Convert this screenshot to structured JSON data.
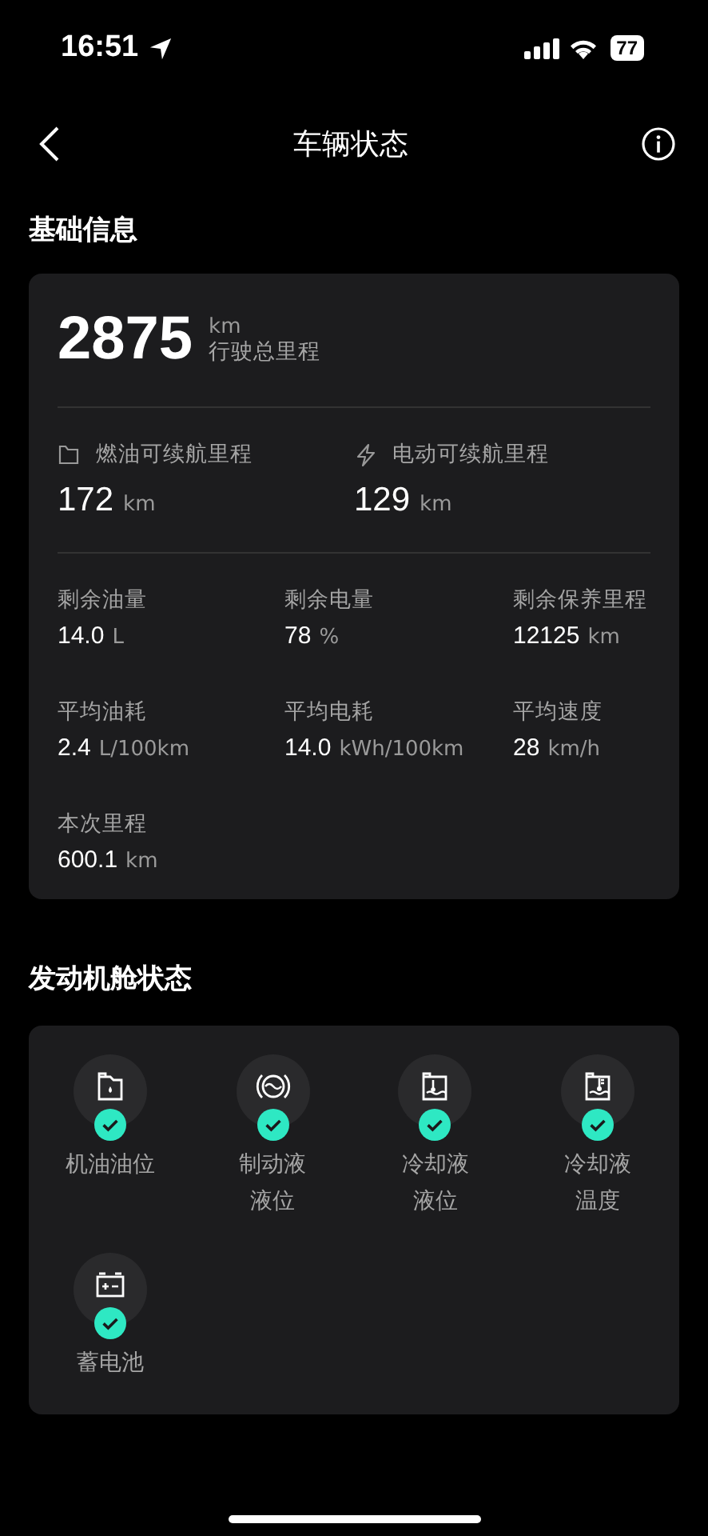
{
  "status_bar": {
    "time": "16:51",
    "battery": "77"
  },
  "nav": {
    "title": "车辆状态"
  },
  "basic": {
    "title": "基础信息",
    "total": {
      "value": "2875",
      "unit": "km",
      "label": "行驶总里程"
    },
    "ranges": [
      {
        "kind": "fuel",
        "label": "燃油可续航里程",
        "value": "172",
        "unit": "km"
      },
      {
        "kind": "electric",
        "label": "电动可续航里程",
        "value": "129",
        "unit": "km"
      }
    ],
    "stats": [
      {
        "label": "剩余油量",
        "value": "14.0",
        "unit": "L"
      },
      {
        "label": "剩余电量",
        "value": "78",
        "unit": "%"
      },
      {
        "label": "剩余保养里程",
        "value": "12125",
        "unit": "km"
      },
      {
        "label": "平均油耗",
        "value": "2.4",
        "unit": "L/100km"
      },
      {
        "label": "平均电耗",
        "value": "14.0",
        "unit": "kWh/100km"
      },
      {
        "label": "平均速度",
        "value": "28",
        "unit": "km/h"
      },
      {
        "label": "本次里程",
        "value": "600.1",
        "unit": "km"
      }
    ]
  },
  "engine": {
    "title": "发动机舱状态",
    "items": [
      {
        "kind": "oil",
        "ok": true,
        "label_lines": [
          "机油油位"
        ]
      },
      {
        "kind": "brake",
        "ok": true,
        "label_lines": [
          "制动液",
          "液位"
        ]
      },
      {
        "kind": "coolant_level",
        "ok": true,
        "label_lines": [
          "冷却液",
          "液位"
        ]
      },
      {
        "kind": "coolant_temp",
        "ok": true,
        "label_lines": [
          "冷却液",
          "温度"
        ]
      },
      {
        "kind": "battery",
        "ok": true,
        "label_lines": [
          "蓄电池"
        ]
      }
    ]
  }
}
